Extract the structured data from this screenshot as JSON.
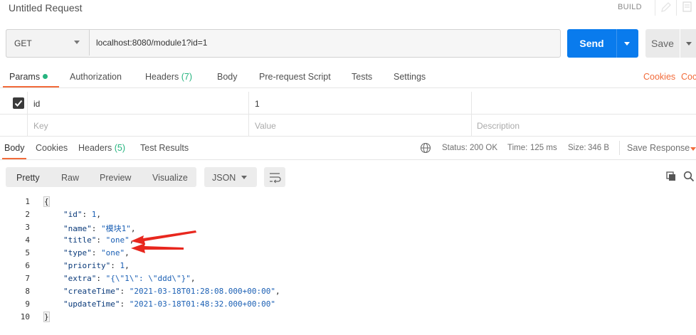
{
  "window": {
    "title": "Untitled Request",
    "build_label": "BUILD"
  },
  "request": {
    "method": "GET",
    "url": "localhost:8080/module1?id=1",
    "send_label": "Send",
    "save_label": "Save"
  },
  "request_tabs": {
    "params": "Params",
    "authorization": "Authorization",
    "headers": "Headers",
    "headers_count": "(7)",
    "body": "Body",
    "prerequest": "Pre-request Script",
    "tests": "Tests",
    "settings": "Settings",
    "cookies": "Cookies",
    "code": "Coc"
  },
  "params_table": {
    "rows": [
      {
        "key": "id",
        "value": "1",
        "description": ""
      }
    ],
    "placeholder": {
      "key": "Key",
      "value": "Value",
      "description": "Description"
    }
  },
  "response_tabs": {
    "body": "Body",
    "cookies": "Cookies",
    "headers": "Headers",
    "headers_count": "(5)",
    "test_results": "Test Results"
  },
  "response_meta": {
    "status_label": "Status:",
    "status_value": "200 OK",
    "time_label": "Time:",
    "time_value": "125 ms",
    "size_label": "Size:",
    "size_value": "346 B",
    "save_response": "Save Response"
  },
  "response_toolbar": {
    "pretty": "Pretty",
    "raw": "Raw",
    "preview": "Preview",
    "visualize": "Visualize",
    "language": "JSON"
  },
  "code": {
    "line_numbers": [
      "1",
      "2",
      "3",
      "4",
      "5",
      "6",
      "7",
      "8",
      "9",
      "10"
    ],
    "open_brace": "{",
    "close_brace": "}",
    "fields": [
      {
        "key": "\"id\"",
        "value": "1"
      },
      {
        "key": "\"name\"",
        "value": "\"模块1\""
      },
      {
        "key": "\"title\"",
        "value": "\"one\""
      },
      {
        "key": "\"type\"",
        "value": "\"one\""
      },
      {
        "key": "\"priority\"",
        "value": "1"
      },
      {
        "key": "\"extra\"",
        "value": "\"{\\\"1\\\": \\\"ddd\\\"}\""
      },
      {
        "key": "\"createTime\"",
        "value": "\"2021-03-18T01:28:08.000+00:00\""
      },
      {
        "key": "\"updateTime\"",
        "value": "\"2021-03-18T01:48:32.000+00:00\""
      }
    ]
  },
  "colors": {
    "accent": "#f26b3a",
    "primary": "#097bed",
    "success": "#26b47f",
    "annotation": "#e8271e"
  },
  "icons": [
    "pencil-icon",
    "document-icon",
    "checkbox-icon",
    "globe-icon",
    "copy-icon",
    "search-icon",
    "wrap-icon"
  ]
}
